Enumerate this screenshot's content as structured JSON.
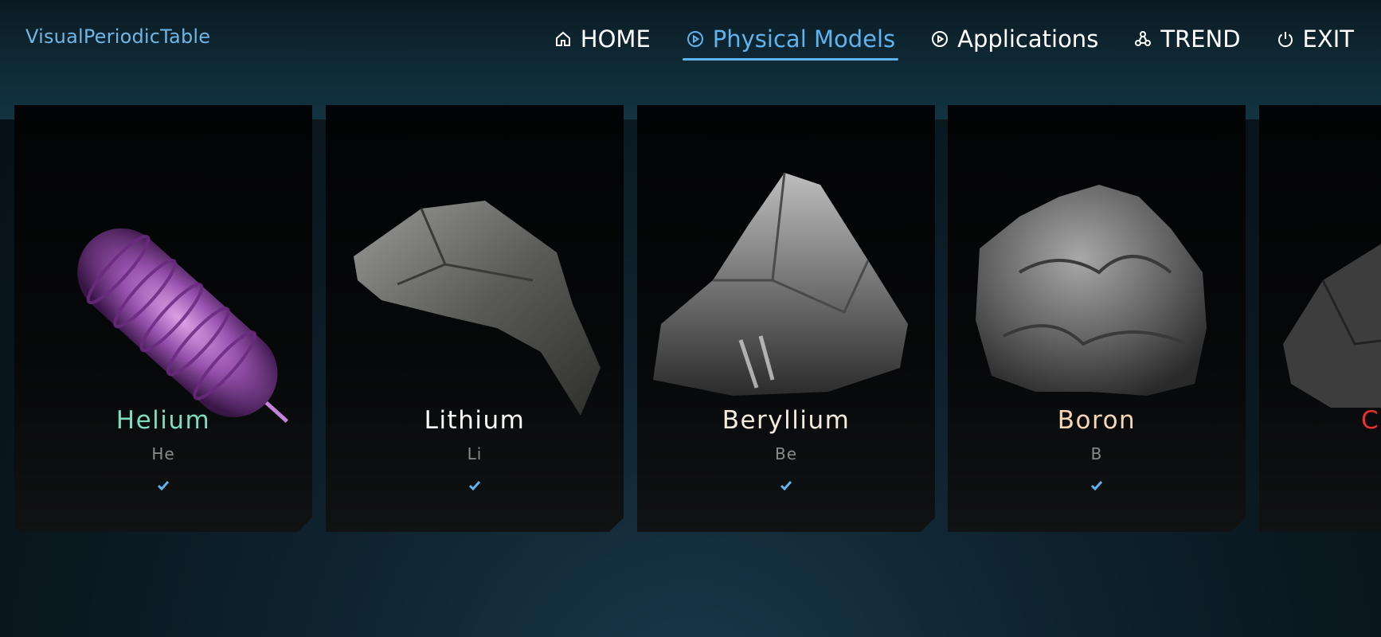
{
  "app": {
    "brand": "VisualPeriodicTable"
  },
  "nav": {
    "items": [
      {
        "label": "HOME",
        "icon": "home-icon",
        "active": false
      },
      {
        "label": "Physical Models",
        "icon": "play-circle-icon",
        "active": true
      },
      {
        "label": "Applications",
        "icon": "play-circle-icon",
        "active": false
      },
      {
        "label": "TREND",
        "icon": "molecule-icon",
        "active": false
      },
      {
        "label": "EXIT",
        "icon": "power-icon",
        "active": false
      }
    ],
    "accent_color": "#5fb3ee"
  },
  "elements": [
    {
      "name": "Helium",
      "symbol": "He",
      "name_color": "#7fdcc0",
      "checked": true,
      "visual": "helium-gas-tube"
    },
    {
      "name": "Lithium",
      "symbol": "Li",
      "name_color": "#ffffff",
      "checked": true,
      "visual": "lithium-metal-chunk"
    },
    {
      "name": "Beryllium",
      "symbol": "Be",
      "name_color": "#f4ece0",
      "checked": true,
      "visual": "beryllium-crystal"
    },
    {
      "name": "Boron",
      "symbol": "B",
      "name_color": "#f3d7b8",
      "checked": true,
      "visual": "boron-lumps"
    },
    {
      "name": "C",
      "symbol": "",
      "name_color": "#e8312f",
      "checked": false,
      "visual": "carbon-partial"
    }
  ]
}
